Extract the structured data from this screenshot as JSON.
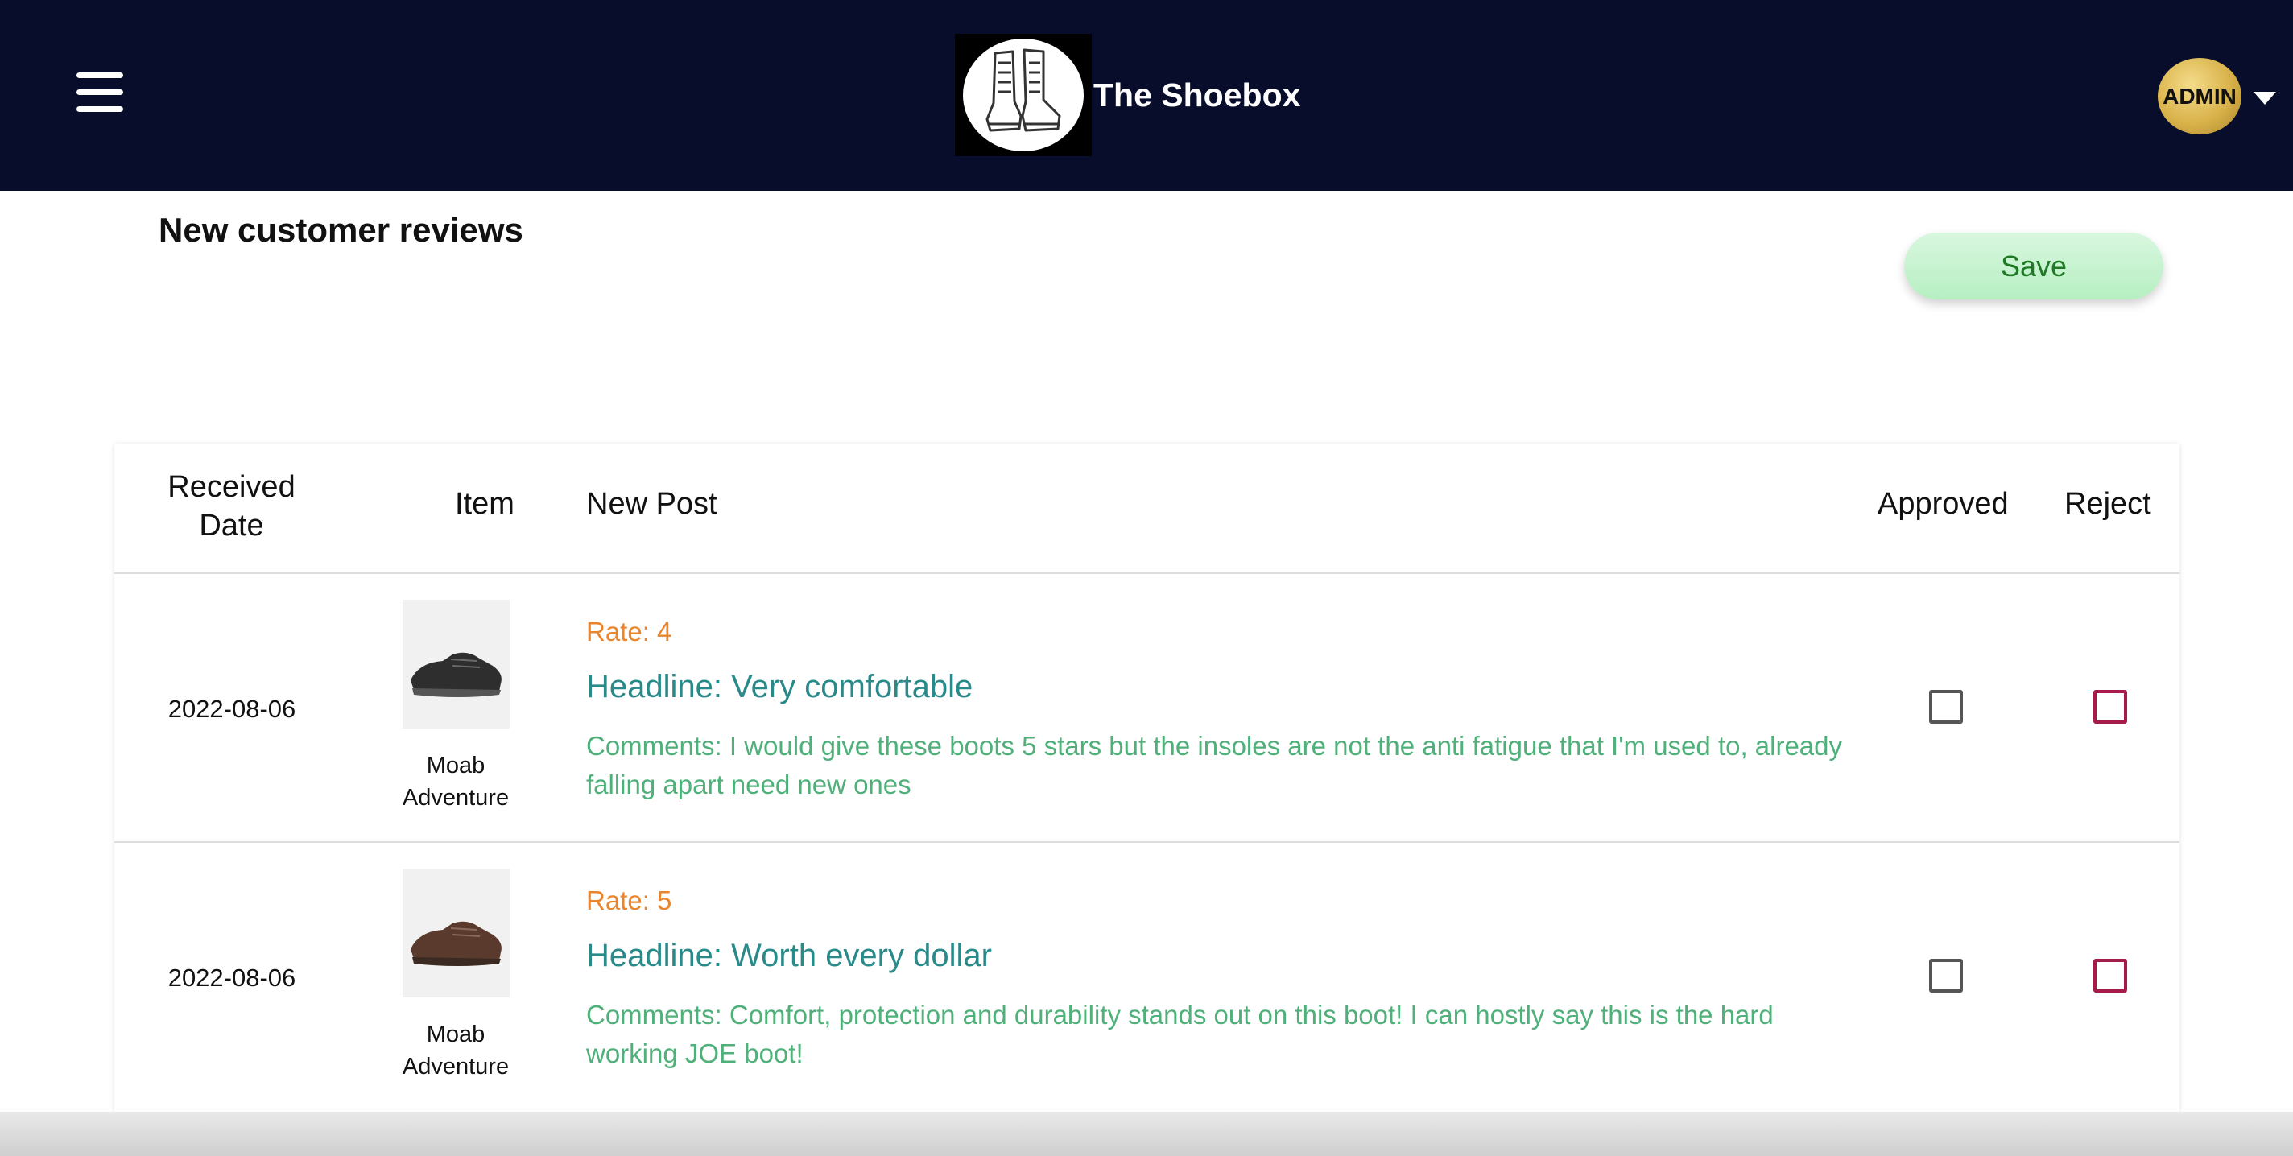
{
  "header": {
    "brand_name": "The Shoebox",
    "user_badge": "ADMIN",
    "background": "#070d2a"
  },
  "main": {
    "title": "New customer reviews",
    "save_label": "Save"
  },
  "table": {
    "columns": [
      "Received Date",
      "Item",
      "New Post",
      "Approved",
      "Reject"
    ],
    "rows": [
      {
        "date": "2022-08-06",
        "item": "Moab Adventure",
        "rate": "Rate: 4",
        "headline": "Headline: Very comfortable",
        "comments": "Comments: I would give these boots 5 stars but the insoles are not the anti fatigue that I'm used to, already falling apart need new ones",
        "approved": false,
        "rejected": false
      },
      {
        "date": "2022-08-06",
        "item": "Moab Adventure",
        "rate": "Rate: 5",
        "headline": "Headline: Worth every dollar",
        "comments": "Comments: Comfort, protection and durability stands out on this boot! I can hostly say this is the hard working JOE boot!",
        "approved": false,
        "rejected": false
      }
    ]
  },
  "colors": {
    "rate": "#e8852d",
    "headline": "#2a8a8a",
    "comments": "#4fb07a",
    "reject_checkbox": "#a61b4b",
    "save_text": "#1f7a25"
  }
}
